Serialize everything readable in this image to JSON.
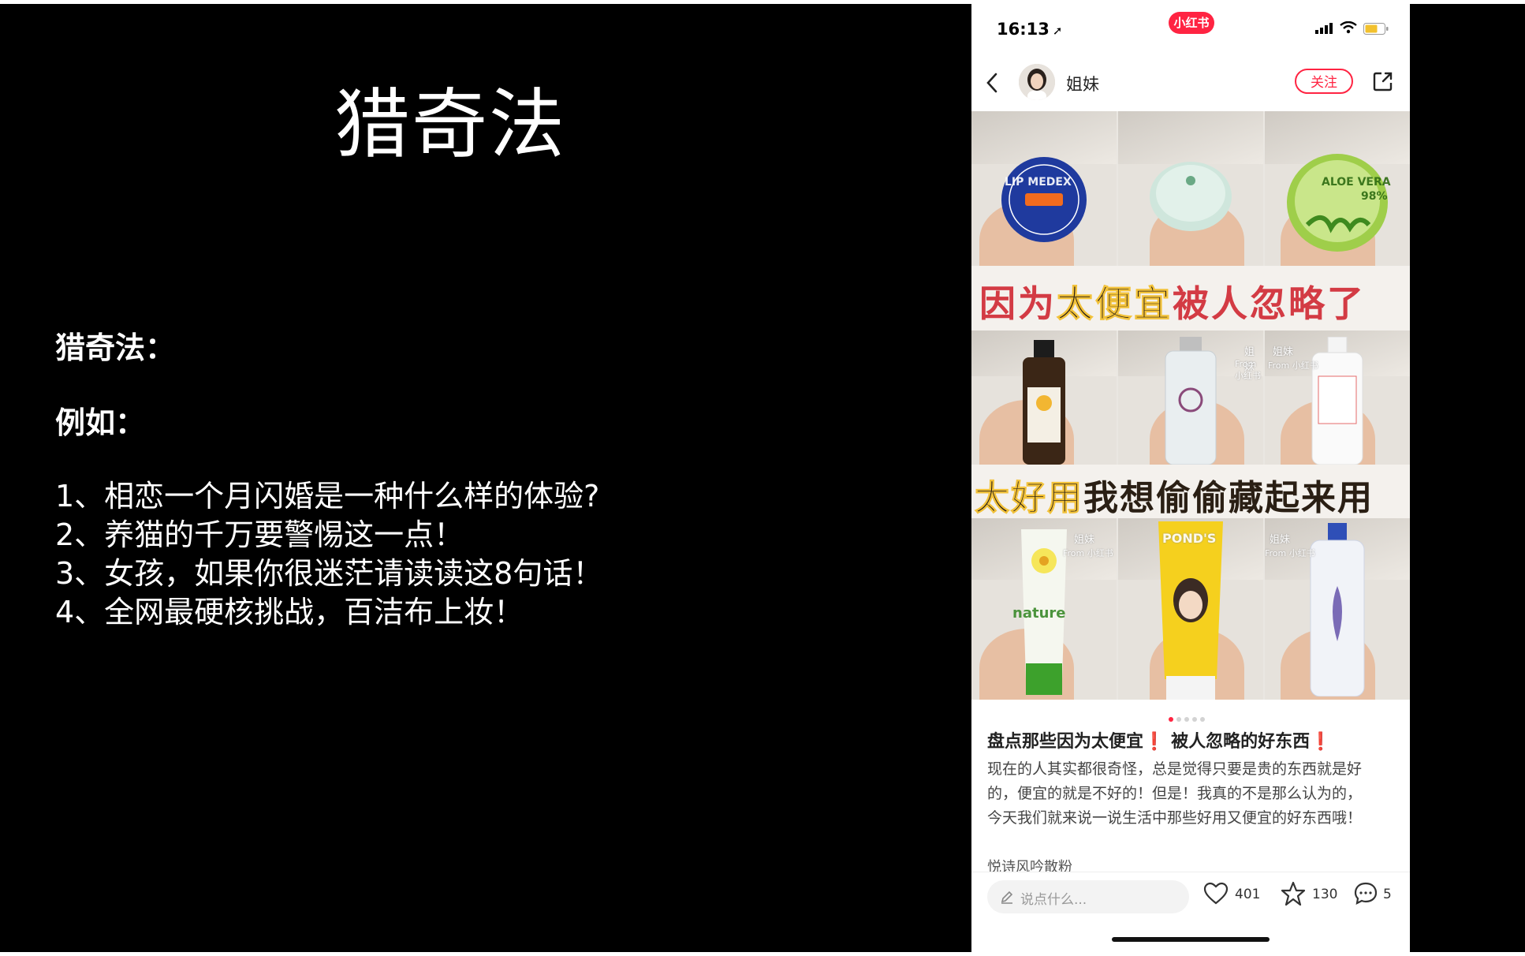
{
  "slide": {
    "title": "猎奇法",
    "heading1": "猎奇法：",
    "heading2": "例如：",
    "items": [
      "1、相恋一个月闪婚是一种什么样的体验?",
      "2、养猫的千万要警惕这一点！",
      "3、女孩，如果你很迷茫请读读这8句话！",
      "4、全网最硬核挑战，百洁布上妆！"
    ]
  },
  "phone": {
    "status": {
      "time": "16:13",
      "time_arrow": "➚",
      "app_badge": "小红书"
    },
    "nav": {
      "author": "姐妹",
      "follow": "关注"
    },
    "images": {
      "banner1_pre": "因为",
      "banner1_hl": "太便宜",
      "banner1_post": "被人忽略了",
      "banner2_hl": "太好用",
      "banner2_post": "我想偷偷藏起来用",
      "tiles": {
        "t1": "LIP MEDEX",
        "t3": "ALOE VERA",
        "t3b": "98%",
        "t8": "POND'S",
        "t7": "nature"
      },
      "watermark_name": "姐妹",
      "watermark_from": "From 小红书"
    },
    "carousel": {
      "count": 5,
      "active": 0
    },
    "post": {
      "title_part1": "盘点那些因为太便宜",
      "title_mark1": "❗",
      "title_part2": "被人忽略的好东西",
      "title_mark2": "❗",
      "body_lines": [
        "现在的人其实都很奇怪，总是觉得只要是贵的东西就是好",
        "的，便宜的就是不好的！但是！我真的不是那么认为的，",
        "今天我们就来说一说生活中那些好用又便宜的好东西哦！"
      ],
      "tag_line": "悦诗风吟散粉"
    },
    "bottom": {
      "comment_placeholder": "说点什么...",
      "likes": "401",
      "collects": "130",
      "comments": "5"
    }
  },
  "colors": {
    "accent": "#ff2442",
    "slide_bg": "#000000"
  }
}
